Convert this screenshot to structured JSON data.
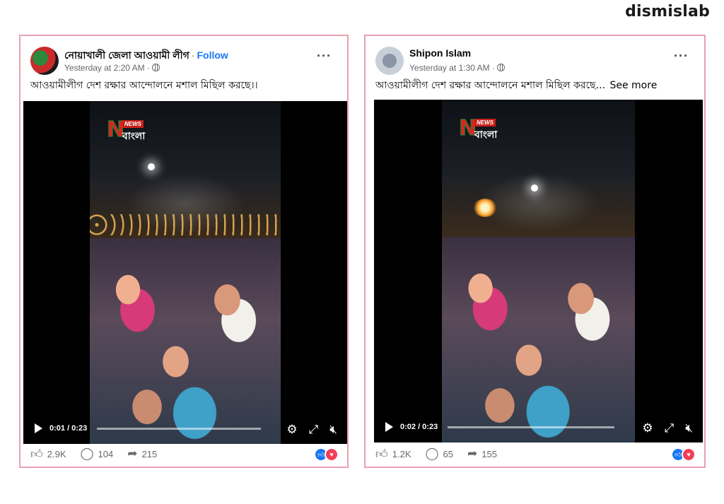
{
  "brand": "dismislab",
  "posts": [
    {
      "author": "নোয়াখালী জেলা আওয়ামী লীগ",
      "separator": "·",
      "follow_label": "Follow",
      "timestamp": "Yesterday at 2:20 AM",
      "more_label": "···",
      "caption": "আওয়ামীলীগ দেশ রক্ষার আন্দোলনে মশাল মিছিল করছে।।",
      "see_more": "",
      "video": {
        "time": "0:01 / 0:23",
        "logo_news": "NEWS",
        "logo_bangla": "বাংলা"
      },
      "likes": "2.9K",
      "comments": "104",
      "shares": "215"
    },
    {
      "author": "Shipon Islam",
      "separator": "",
      "follow_label": "",
      "timestamp": "Yesterday at 1:30 AM",
      "more_label": "···",
      "caption": "আওয়ামীলীগ দেশ রক্ষার আন্দোলনে মশাল মিছিল করছে...",
      "see_more": "See more",
      "video": {
        "time": "0:02 / 0:23",
        "logo_news": "NEWS",
        "logo_bangla": "বাংলা"
      },
      "likes": "1.2K",
      "comments": "65",
      "shares": "155"
    }
  ],
  "icons": {
    "play": "play-icon",
    "settings": "gear-icon",
    "fullscreen": "expand-icon",
    "mute": "muted-speaker-icon",
    "like": "thumbs-up-icon",
    "comment": "comment-icon",
    "share": "share-icon",
    "globe": "globe-icon"
  },
  "colors": {
    "frame_border": "#e7a0b0",
    "link": "#1877f2",
    "like": "#1877f2",
    "love": "#f33e58"
  }
}
